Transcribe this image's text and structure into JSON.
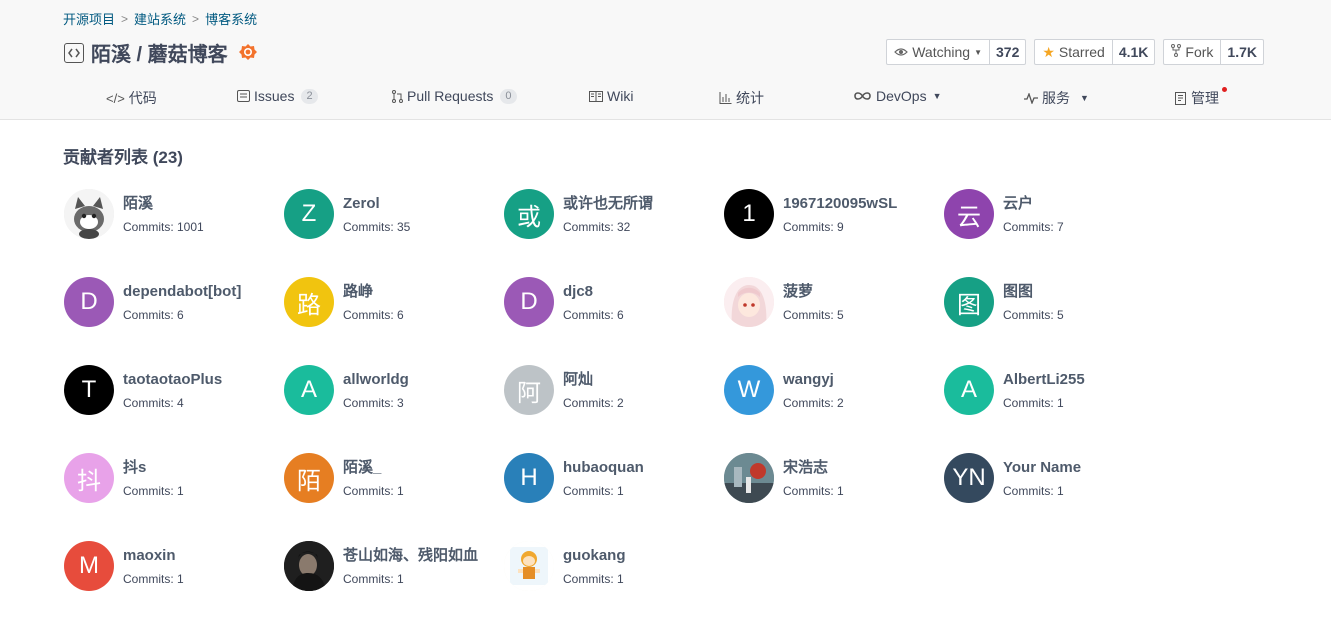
{
  "breadcrumb": [
    "开源项目",
    "建站系统",
    "博客系统"
  ],
  "repo": {
    "name": "陌溪 / 蘑菇博客"
  },
  "actions": {
    "watch": {
      "label": "Watching",
      "count": "372"
    },
    "star": {
      "label": "Starred",
      "count": "4.1K"
    },
    "fork": {
      "label": "Fork",
      "count": "1.7K"
    }
  },
  "tabs": {
    "code": "代码",
    "issues": "Issues",
    "issues_count": "2",
    "pulls": "Pull Requests",
    "pulls_count": "0",
    "wiki": "Wiki",
    "stats": "统计",
    "devops": "DevOps",
    "service": "服务",
    "manage": "管理"
  },
  "section": {
    "title": "贡献者列表 (23)"
  },
  "contributors": [
    {
      "name": "陌溪",
      "commits": "Commits: 1001",
      "avatar": "",
      "color": "#e8e8e8",
      "image": "cat"
    },
    {
      "name": "Zerol",
      "commits": "Commits: 35",
      "avatar": "Z",
      "color": "#16a085"
    },
    {
      "name": "或许也无所谓",
      "commits": "Commits: 32",
      "avatar": "或",
      "color": "#16a085"
    },
    {
      "name": "1967120095wSL",
      "commits": "Commits: 9",
      "avatar": "1",
      "color": "#000000"
    },
    {
      "name": "云户",
      "commits": "Commits: 7",
      "avatar": "云",
      "color": "#8e44ad"
    },
    {
      "name": "dependabot[bot]",
      "commits": "Commits: 6",
      "avatar": "D",
      "color": "#9b59b6"
    },
    {
      "name": "路峥",
      "commits": "Commits: 6",
      "avatar": "路",
      "color": "#f1c40f"
    },
    {
      "name": "djc8",
      "commits": "Commits: 6",
      "avatar": "D",
      "color": "#9b59b6"
    },
    {
      "name": "菠萝",
      "commits": "Commits: 5",
      "avatar": "",
      "color": "#f6e3e3",
      "image": "anime"
    },
    {
      "name": "图图",
      "commits": "Commits: 5",
      "avatar": "图",
      "color": "#16a085"
    },
    {
      "name": "taotaotaoPlus",
      "commits": "Commits: 4",
      "avatar": "T",
      "color": "#000000"
    },
    {
      "name": "allworldg",
      "commits": "Commits: 3",
      "avatar": "A",
      "color": "#1abc9c"
    },
    {
      "name": "阿灿",
      "commits": "Commits: 2",
      "avatar": "阿",
      "color": "#bdc3c7"
    },
    {
      "name": "wangyj",
      "commits": "Commits: 2",
      "avatar": "W",
      "color": "#3498db"
    },
    {
      "name": "AlbertLi255",
      "commits": "Commits: 1",
      "avatar": "A",
      "color": "#1abc9c"
    },
    {
      "name": "抖s",
      "commits": "Commits: 1",
      "avatar": "抖",
      "color": "#e8a2e9"
    },
    {
      "name": "陌溪_",
      "commits": "Commits: 1",
      "avatar": "陌",
      "color": "#e67e22"
    },
    {
      "name": "hubaoquan",
      "commits": "Commits: 1",
      "avatar": "H",
      "color": "#2980b9"
    },
    {
      "name": "宋浩志",
      "commits": "Commits: 1",
      "avatar": "",
      "color": "#7a8a90",
      "image": "photo"
    },
    {
      "name": "Your Name",
      "commits": "Commits: 1",
      "avatar": "YN",
      "color": "#34495e"
    },
    {
      "name": "maoxin",
      "commits": "Commits: 1",
      "avatar": "M",
      "color": "#e74c3c"
    },
    {
      "name": "苍山如海、残阳如血",
      "commits": "Commits: 1",
      "avatar": "",
      "color": "#2b2b2b",
      "image": "dark"
    },
    {
      "name": "guokang",
      "commits": "Commits: 1",
      "avatar": "",
      "color": "#f7f2e8",
      "image": "cartoon"
    }
  ]
}
